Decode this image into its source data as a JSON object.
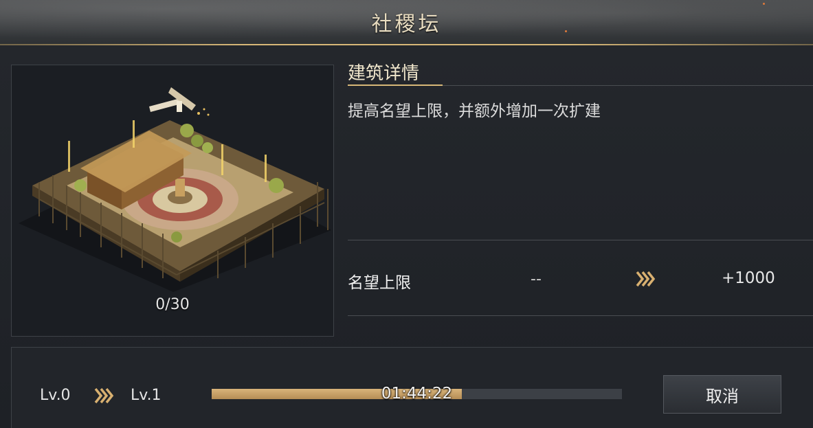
{
  "header": {
    "title": "社稷坛"
  },
  "preview": {
    "progress_text": "0/30",
    "icon": "hammer-icon"
  },
  "details": {
    "title": "建筑详情",
    "description": "提高名望上限，并额外增加一次扩建",
    "stat": {
      "label": "名望上限",
      "current": "--",
      "next": "+1000",
      "arrow_icon": "triple-chevron-right-icon"
    }
  },
  "upgrade": {
    "from_level": "Lv.0",
    "to_level": "Lv.1",
    "timer": "01:44:22",
    "progress_fraction": 0.61,
    "cancel_label": "取消"
  },
  "colors": {
    "accent_gold": "#d8b878",
    "progress_fill": "#c9a468",
    "track": "#3c4046"
  }
}
